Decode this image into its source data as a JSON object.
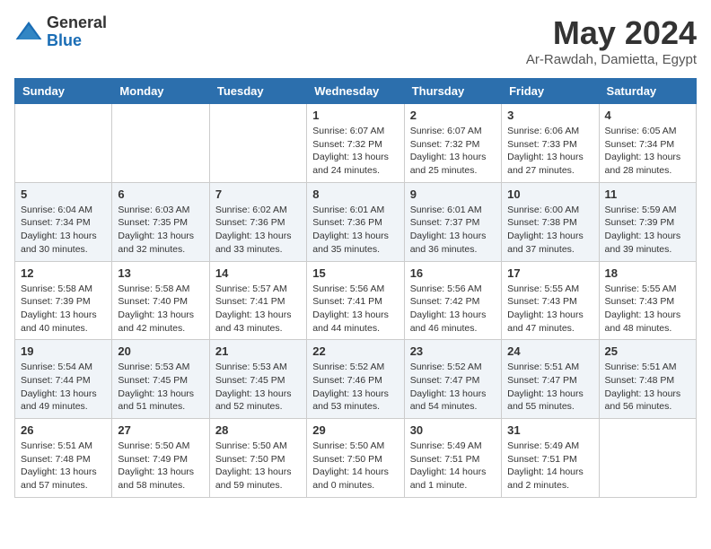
{
  "logo": {
    "general": "General",
    "blue": "Blue"
  },
  "title": "May 2024",
  "location": "Ar-Rawdah, Damietta, Egypt",
  "weekdays": [
    "Sunday",
    "Monday",
    "Tuesday",
    "Wednesday",
    "Thursday",
    "Friday",
    "Saturday"
  ],
  "weeks": [
    [
      {
        "day": "",
        "info": ""
      },
      {
        "day": "",
        "info": ""
      },
      {
        "day": "",
        "info": ""
      },
      {
        "day": "1",
        "info": "Sunrise: 6:07 AM\nSunset: 7:32 PM\nDaylight: 13 hours\nand 24 minutes."
      },
      {
        "day": "2",
        "info": "Sunrise: 6:07 AM\nSunset: 7:32 PM\nDaylight: 13 hours\nand 25 minutes."
      },
      {
        "day": "3",
        "info": "Sunrise: 6:06 AM\nSunset: 7:33 PM\nDaylight: 13 hours\nand 27 minutes."
      },
      {
        "day": "4",
        "info": "Sunrise: 6:05 AM\nSunset: 7:34 PM\nDaylight: 13 hours\nand 28 minutes."
      }
    ],
    [
      {
        "day": "5",
        "info": "Sunrise: 6:04 AM\nSunset: 7:34 PM\nDaylight: 13 hours\nand 30 minutes."
      },
      {
        "day": "6",
        "info": "Sunrise: 6:03 AM\nSunset: 7:35 PM\nDaylight: 13 hours\nand 32 minutes."
      },
      {
        "day": "7",
        "info": "Sunrise: 6:02 AM\nSunset: 7:36 PM\nDaylight: 13 hours\nand 33 minutes."
      },
      {
        "day": "8",
        "info": "Sunrise: 6:01 AM\nSunset: 7:36 PM\nDaylight: 13 hours\nand 35 minutes."
      },
      {
        "day": "9",
        "info": "Sunrise: 6:01 AM\nSunset: 7:37 PM\nDaylight: 13 hours\nand 36 minutes."
      },
      {
        "day": "10",
        "info": "Sunrise: 6:00 AM\nSunset: 7:38 PM\nDaylight: 13 hours\nand 37 minutes."
      },
      {
        "day": "11",
        "info": "Sunrise: 5:59 AM\nSunset: 7:39 PM\nDaylight: 13 hours\nand 39 minutes."
      }
    ],
    [
      {
        "day": "12",
        "info": "Sunrise: 5:58 AM\nSunset: 7:39 PM\nDaylight: 13 hours\nand 40 minutes."
      },
      {
        "day": "13",
        "info": "Sunrise: 5:58 AM\nSunset: 7:40 PM\nDaylight: 13 hours\nand 42 minutes."
      },
      {
        "day": "14",
        "info": "Sunrise: 5:57 AM\nSunset: 7:41 PM\nDaylight: 13 hours\nand 43 minutes."
      },
      {
        "day": "15",
        "info": "Sunrise: 5:56 AM\nSunset: 7:41 PM\nDaylight: 13 hours\nand 44 minutes."
      },
      {
        "day": "16",
        "info": "Sunrise: 5:56 AM\nSunset: 7:42 PM\nDaylight: 13 hours\nand 46 minutes."
      },
      {
        "day": "17",
        "info": "Sunrise: 5:55 AM\nSunset: 7:43 PM\nDaylight: 13 hours\nand 47 minutes."
      },
      {
        "day": "18",
        "info": "Sunrise: 5:55 AM\nSunset: 7:43 PM\nDaylight: 13 hours\nand 48 minutes."
      }
    ],
    [
      {
        "day": "19",
        "info": "Sunrise: 5:54 AM\nSunset: 7:44 PM\nDaylight: 13 hours\nand 49 minutes."
      },
      {
        "day": "20",
        "info": "Sunrise: 5:53 AM\nSunset: 7:45 PM\nDaylight: 13 hours\nand 51 minutes."
      },
      {
        "day": "21",
        "info": "Sunrise: 5:53 AM\nSunset: 7:45 PM\nDaylight: 13 hours\nand 52 minutes."
      },
      {
        "day": "22",
        "info": "Sunrise: 5:52 AM\nSunset: 7:46 PM\nDaylight: 13 hours\nand 53 minutes."
      },
      {
        "day": "23",
        "info": "Sunrise: 5:52 AM\nSunset: 7:47 PM\nDaylight: 13 hours\nand 54 minutes."
      },
      {
        "day": "24",
        "info": "Sunrise: 5:51 AM\nSunset: 7:47 PM\nDaylight: 13 hours\nand 55 minutes."
      },
      {
        "day": "25",
        "info": "Sunrise: 5:51 AM\nSunset: 7:48 PM\nDaylight: 13 hours\nand 56 minutes."
      }
    ],
    [
      {
        "day": "26",
        "info": "Sunrise: 5:51 AM\nSunset: 7:48 PM\nDaylight: 13 hours\nand 57 minutes."
      },
      {
        "day": "27",
        "info": "Sunrise: 5:50 AM\nSunset: 7:49 PM\nDaylight: 13 hours\nand 58 minutes."
      },
      {
        "day": "28",
        "info": "Sunrise: 5:50 AM\nSunset: 7:50 PM\nDaylight: 13 hours\nand 59 minutes."
      },
      {
        "day": "29",
        "info": "Sunrise: 5:50 AM\nSunset: 7:50 PM\nDaylight: 14 hours\nand 0 minutes."
      },
      {
        "day": "30",
        "info": "Sunrise: 5:49 AM\nSunset: 7:51 PM\nDaylight: 14 hours\nand 1 minute."
      },
      {
        "day": "31",
        "info": "Sunrise: 5:49 AM\nSunset: 7:51 PM\nDaylight: 14 hours\nand 2 minutes."
      },
      {
        "day": "",
        "info": ""
      }
    ]
  ]
}
